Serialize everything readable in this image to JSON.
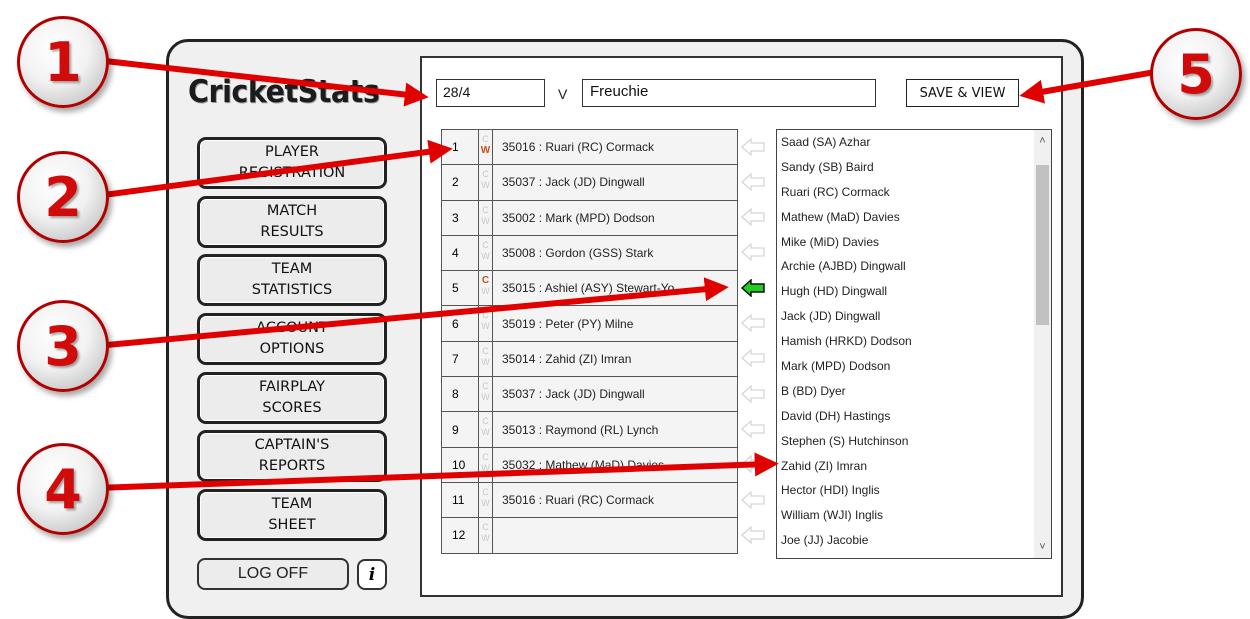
{
  "logo": "CricketStats",
  "nav": [
    {
      "line1": "PLAYER",
      "line2": "REGISTRATION"
    },
    {
      "line1": "MATCH",
      "line2": "RESULTS"
    },
    {
      "line1": "TEAM",
      "line2": "STATISTICS"
    },
    {
      "line1": "ACCOUNT",
      "line2": "OPTIONS"
    },
    {
      "line1": "FAIRPLAY",
      "line2": "SCORES"
    },
    {
      "line1": "CAPTAIN'S",
      "line2": "REPORTS"
    },
    {
      "line1": "TEAM",
      "line2": "SHEET"
    }
  ],
  "logoff_label": "LOG OFF",
  "info_label": "i",
  "match": {
    "score_value": "28/4",
    "vs_label": "V",
    "opponent_value": "Freuchie",
    "save_label": "SAVE & VIEW"
  },
  "captain_label": "C",
  "keeper_label": "W",
  "team_rows": [
    {
      "num": "1",
      "player": "35016 : Ruari (RC) Cormack",
      "captain": false,
      "keeper": true
    },
    {
      "num": "2",
      "player": "35037 : Jack (JD) Dingwall",
      "captain": false,
      "keeper": false
    },
    {
      "num": "3",
      "player": "35002 : Mark (MPD) Dodson",
      "captain": false,
      "keeper": false
    },
    {
      "num": "4",
      "player": "35008 : Gordon (GSS) Stark",
      "captain": false,
      "keeper": false
    },
    {
      "num": "5",
      "player": "35015 : Ashiel (ASY) Stewart-Yo",
      "captain": true,
      "keeper": false
    },
    {
      "num": "6",
      "player": "35019 : Peter (PY) Milne",
      "captain": false,
      "keeper": false
    },
    {
      "num": "7",
      "player": "35014 : Zahid (ZI) Imran",
      "captain": false,
      "keeper": false
    },
    {
      "num": "8",
      "player": "35037 : Jack (JD) Dingwall",
      "captain": false,
      "keeper": false
    },
    {
      "num": "9",
      "player": "35013 : Raymond (RL) Lynch",
      "captain": false,
      "keeper": false
    },
    {
      "num": "10",
      "player": "35032 : Mathew (MaD) Davies",
      "captain": false,
      "keeper": false
    },
    {
      "num": "11",
      "player": "35016 : Ruari (RC) Cormack",
      "captain": false,
      "keeper": false
    },
    {
      "num": "12",
      "player": "",
      "captain": false,
      "keeper": false
    }
  ],
  "active_arrow_row": "5",
  "players": [
    "Saad (SA) Azhar",
    "Sandy (SB) Baird",
    "Ruari (RC) Cormack",
    "Mathew (MaD) Davies",
    "Mike (MiD) Davies",
    "Archie (AJBD) Dingwall",
    "Hugh (HD) Dingwall",
    "Jack (JD) Dingwall",
    "Hamish (HRKD) Dodson",
    "Mark (MPD) Dodson",
    "B (BD) Dyer",
    "David (DH) Hastings",
    "Stephen (S) Hutchinson",
    "Zahid (ZI) Imran",
    "Hector (HDI) Inglis",
    "William (WJI) Inglis",
    "Joe (JJ) Jacobie"
  ],
  "callouts": [
    "1",
    "2",
    "3",
    "4",
    "5"
  ],
  "colors": {
    "callout_red": "#d10a0a",
    "arrow_red": "#e00000",
    "captain_orange": "#c8501a",
    "active_arrow_green": "#22cc22"
  }
}
